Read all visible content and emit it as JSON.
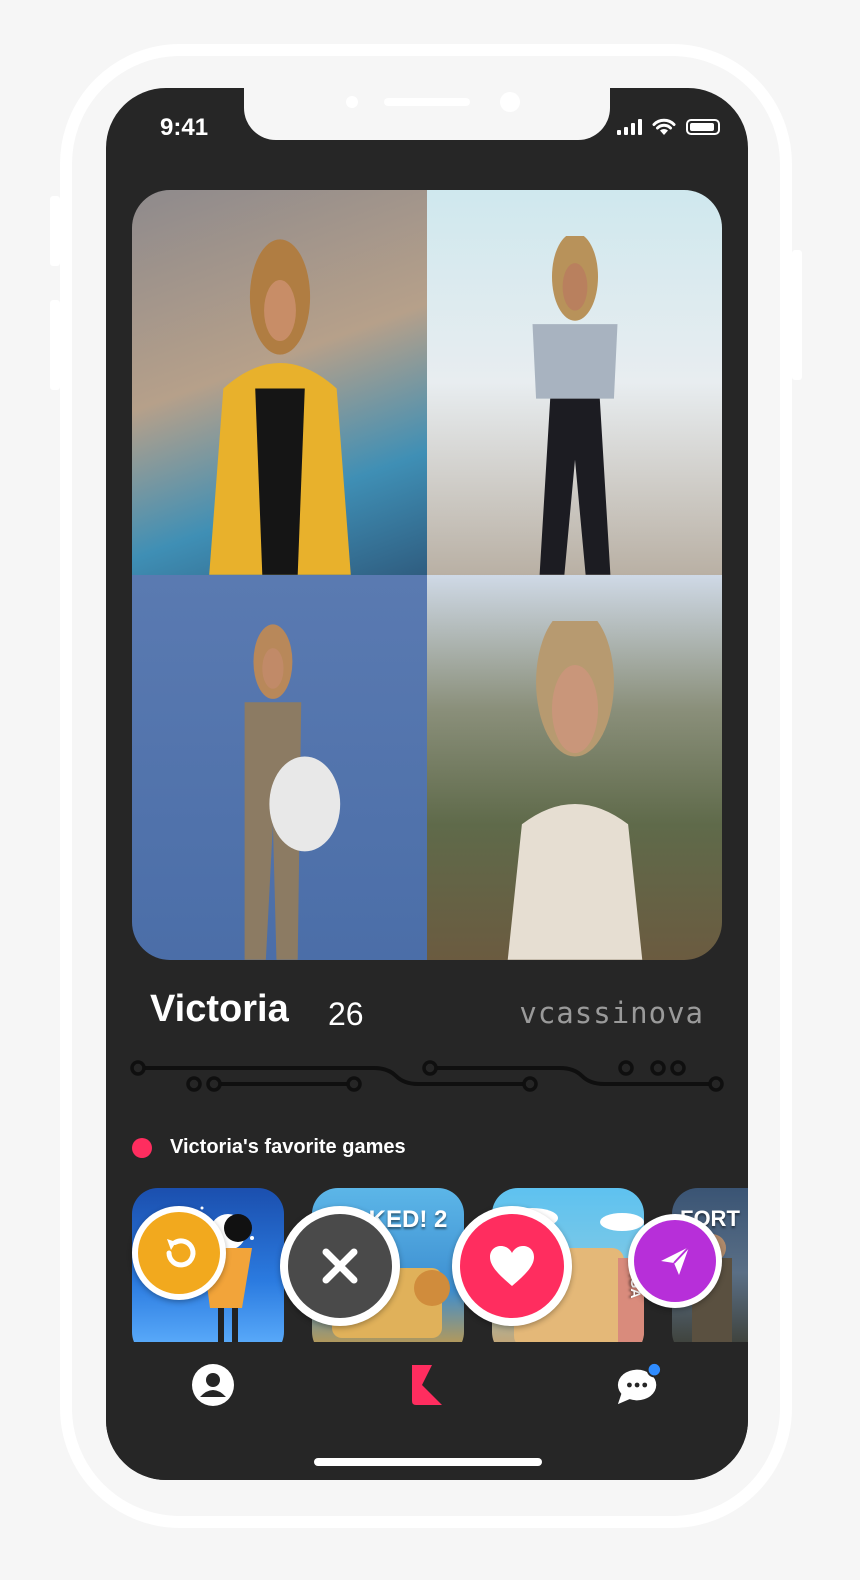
{
  "status_bar": {
    "time": "9:41"
  },
  "profile": {
    "name": "Victoria",
    "age": "26",
    "username": "vcassinova"
  },
  "games_section": {
    "title": "Victoria's favorite games",
    "games": [
      {
        "icon": "monument-valley-icon",
        "text": ""
      },
      {
        "icon": "overcooked-2-icon",
        "text": "OKED! 2"
      },
      {
        "icon": "candy-crush-saga-icon",
        "text": "SAGA"
      },
      {
        "icon": "fortnite-icon",
        "text": "FORT"
      }
    ]
  },
  "actions": [
    {
      "name": "undo-button",
      "icon": "undo-icon",
      "color": "#f2a91e"
    },
    {
      "name": "dislike-button",
      "icon": "close-icon",
      "color": "#4a4a4a"
    },
    {
      "name": "like-button",
      "icon": "heart-icon",
      "color": "#ff2d5f"
    },
    {
      "name": "message-button",
      "icon": "send-icon",
      "color": "#b72fd9"
    }
  ],
  "tab_bar": {
    "items": [
      {
        "icon": "profile-icon"
      },
      {
        "icon": "app-logo-icon",
        "accent": "#ff2d5f"
      },
      {
        "icon": "chat-icon",
        "badge_color": "#2f8cff"
      }
    ]
  },
  "colors": {
    "background": "#262626",
    "accent": "#ff2d5f",
    "text_secondary": "#9a9a9a"
  }
}
